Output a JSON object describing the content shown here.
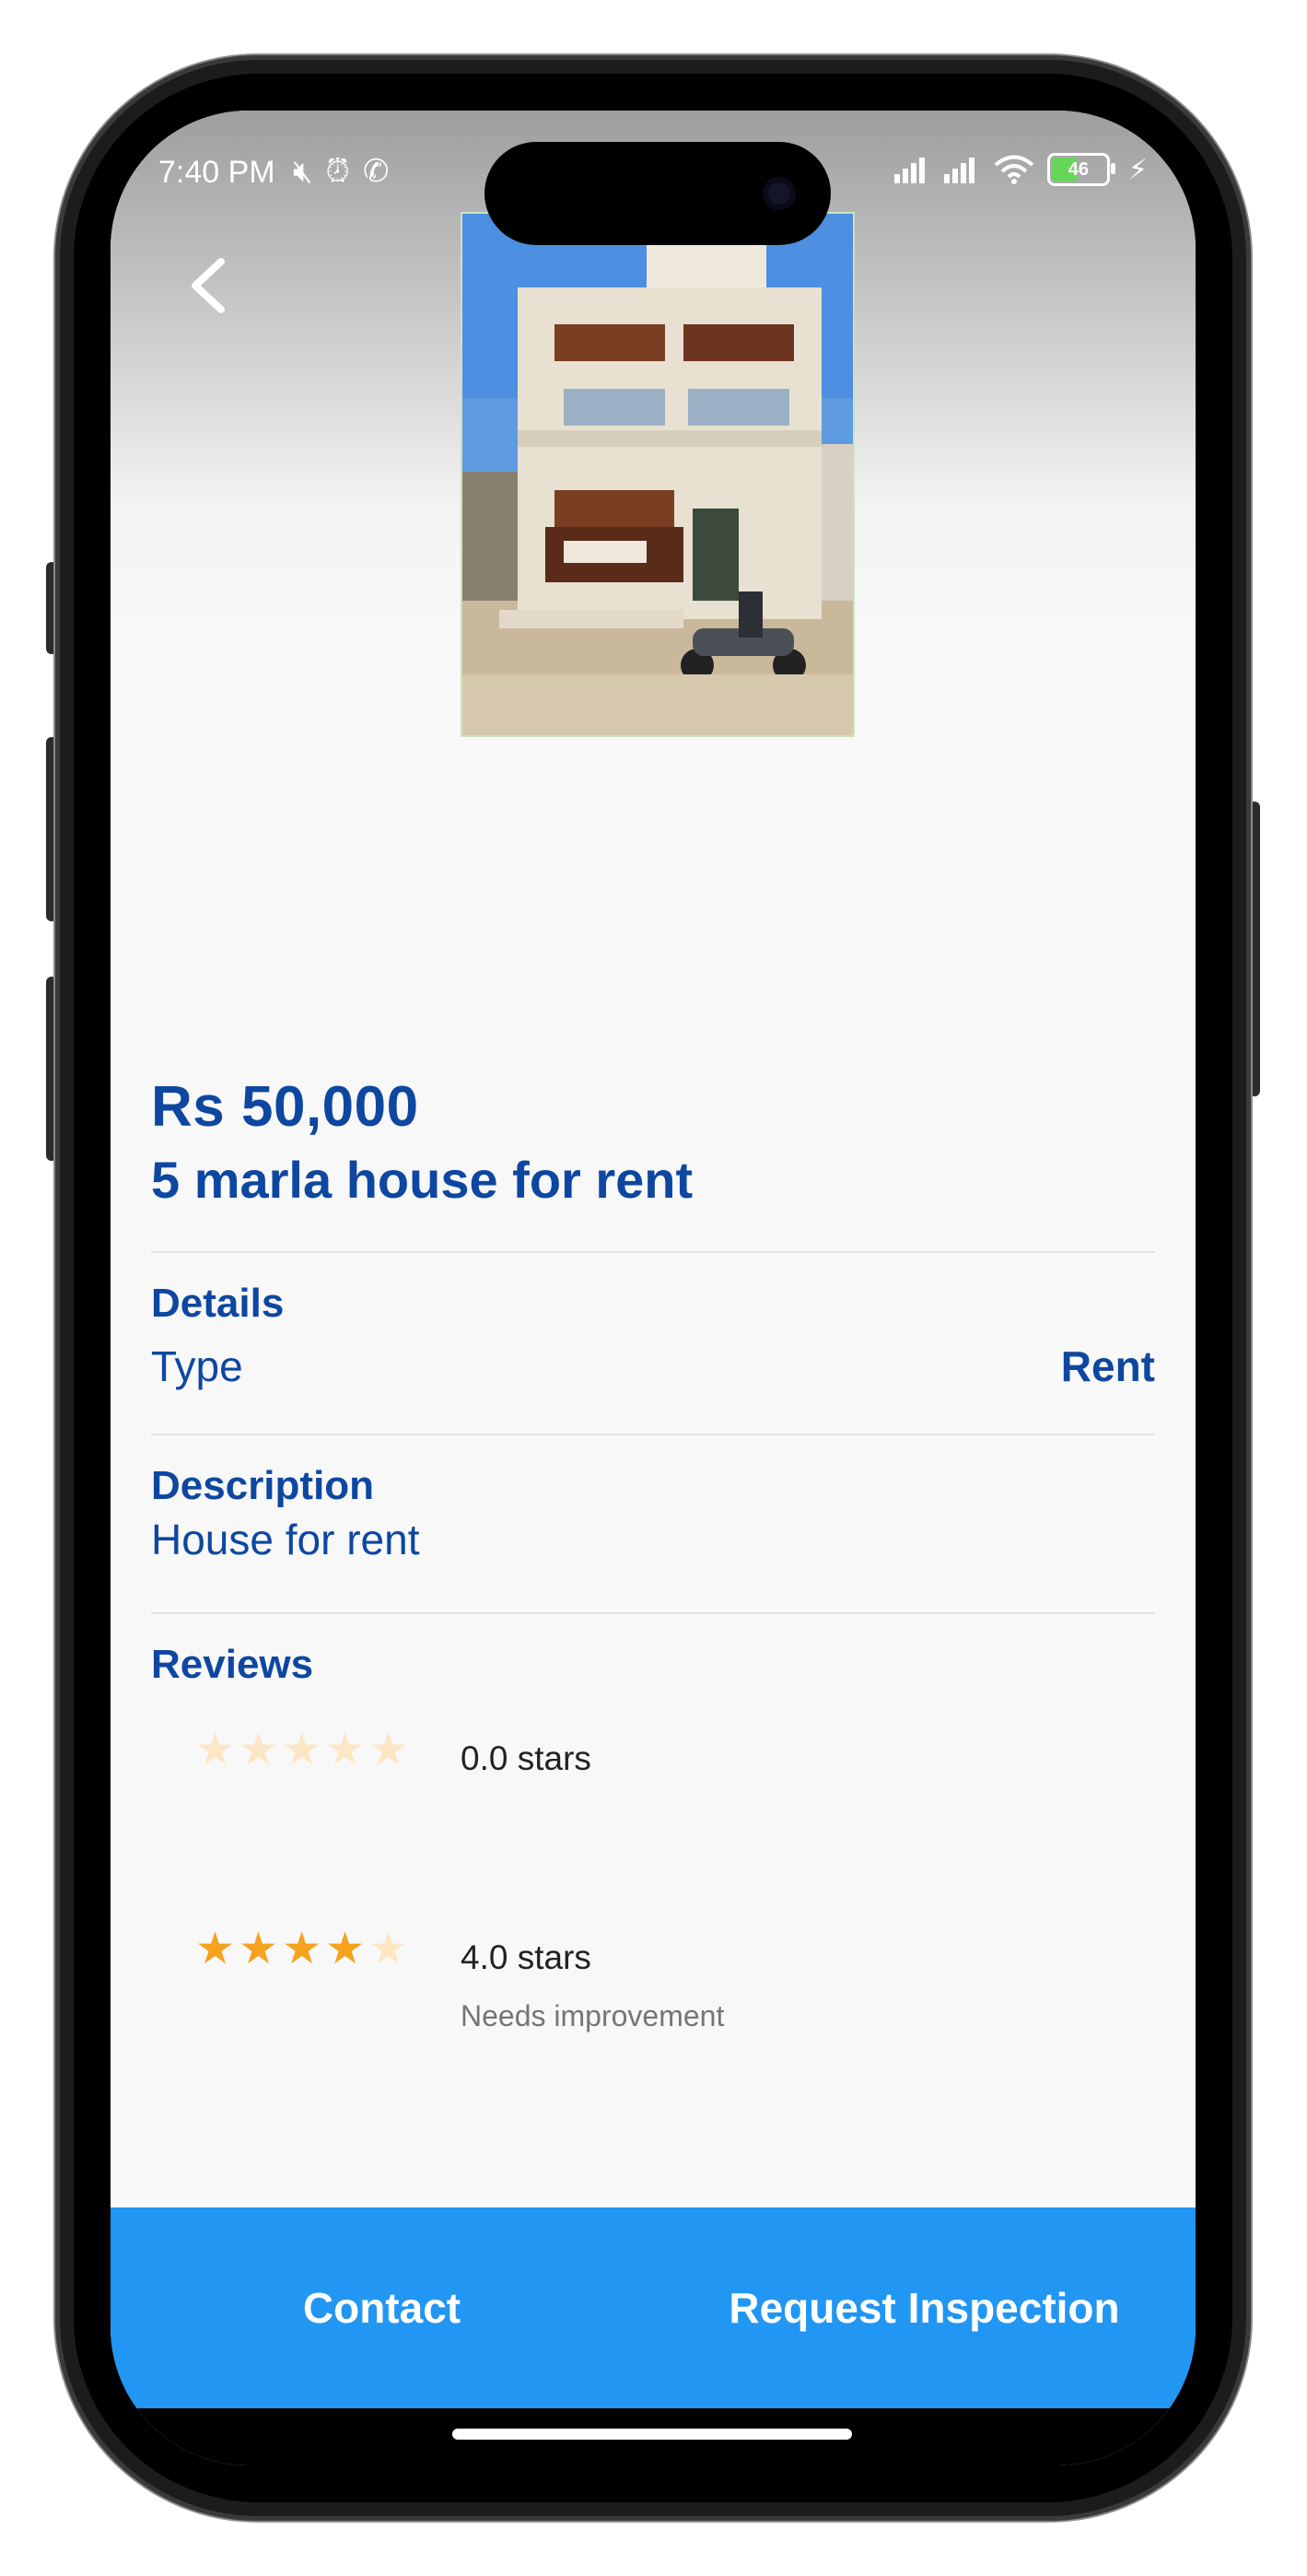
{
  "status_bar": {
    "time": "7:40 PM",
    "battery_level": "46",
    "icons_left": [
      "mute-icon",
      "alarm-icon",
      "whatsapp-icon"
    ],
    "icons_right": [
      "signal-icon",
      "signal-icon",
      "wifi-icon",
      "battery-icon",
      "charging-icon"
    ]
  },
  "listing": {
    "price": "Rs 50,000",
    "title": "5 marla house for rent"
  },
  "details": {
    "heading": "Details",
    "type_label": "Type",
    "type_value": "Rent"
  },
  "description": {
    "heading": "Description",
    "text": "House for rent"
  },
  "reviews": {
    "heading": "Reviews",
    "items": [
      {
        "rating": 0,
        "label": "0.0 stars",
        "comment": ""
      },
      {
        "rating": 4,
        "label": "4.0 stars",
        "comment": "Needs improvement"
      }
    ]
  },
  "actions": {
    "contact": "Contact",
    "request_inspection": "Request Inspection"
  },
  "colors": {
    "primary_text": "#0d47a1",
    "action_bar": "#2196f3",
    "star_filled": "#f5a21f",
    "star_empty": "#fde6c4"
  }
}
